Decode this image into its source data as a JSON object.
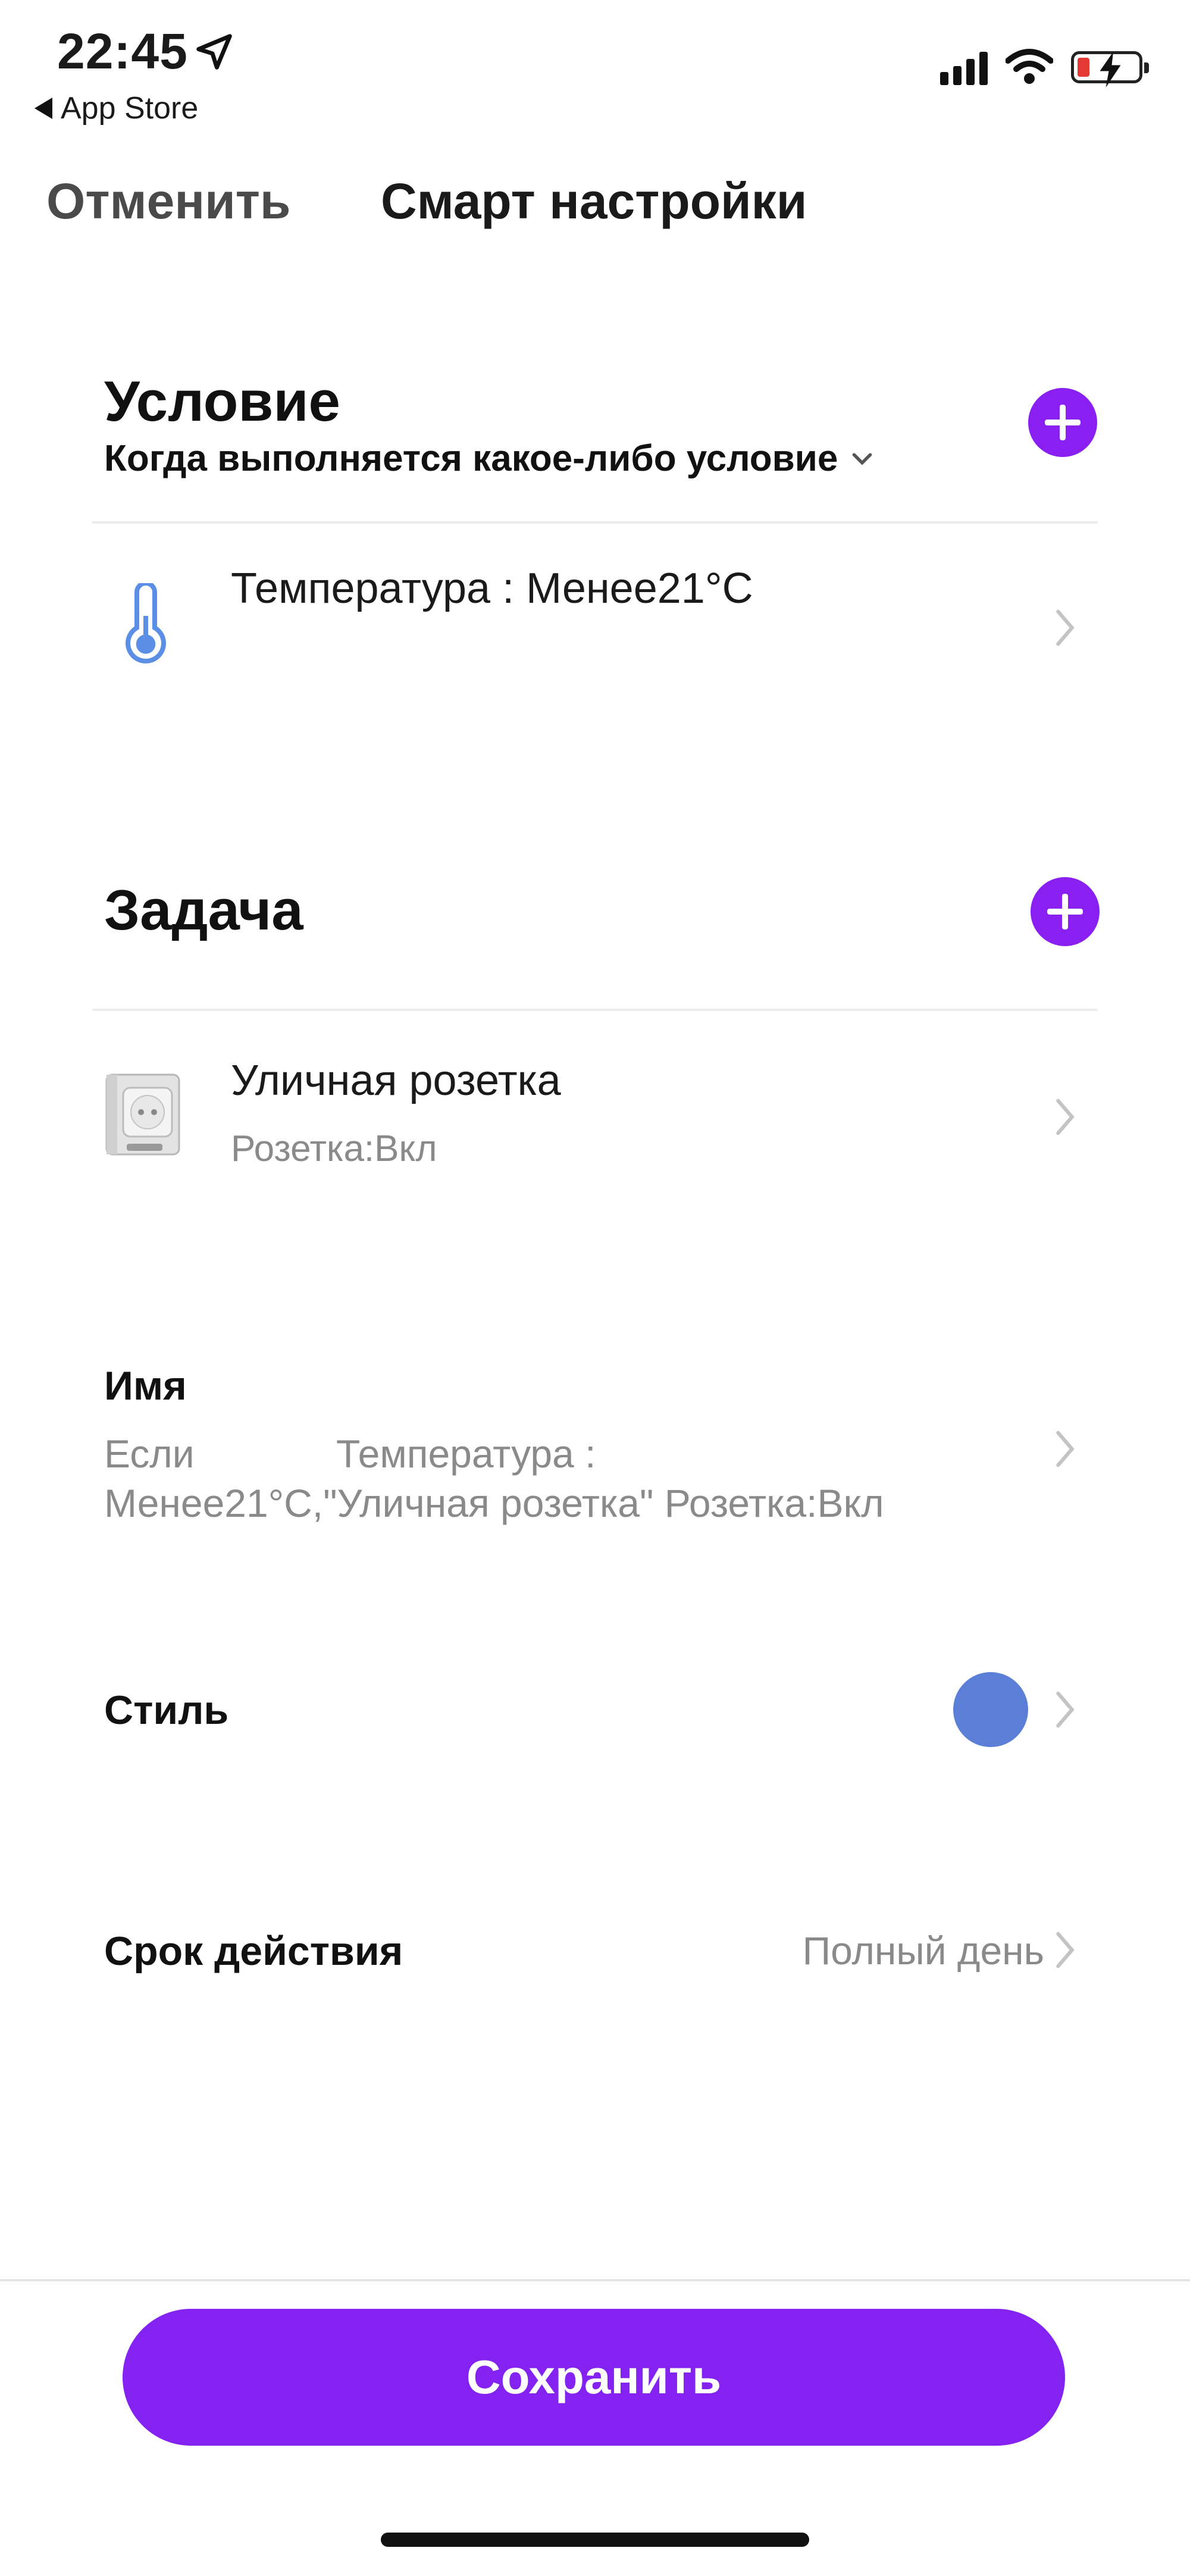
{
  "status_bar": {
    "time": "22:45",
    "back_app": "App Store",
    "battery_color": "#e53935"
  },
  "header": {
    "cancel_label": "Отменить",
    "title": "Смарт настройки"
  },
  "condition": {
    "heading": "Условие",
    "mode_label": "Когда выполняется какое-либо условие",
    "items": [
      {
        "icon": "thermometer-icon",
        "title": "Температура : Менее21°C"
      }
    ]
  },
  "task": {
    "heading": "Задача",
    "items": [
      {
        "icon": "outdoor-socket-icon",
        "title": "Уличная розетка",
        "subtitle": "Розетка:Вкл"
      }
    ]
  },
  "name": {
    "label": "Имя",
    "value_line1": "Если             Температура :",
    "value_line2": "Менее21°C,\"Уличная розетка\" Розетка:Вкл"
  },
  "style": {
    "label": "Стиль",
    "color": "#5b7fd6"
  },
  "validity": {
    "label": "Срок действия",
    "value": "Полный день"
  },
  "footer": {
    "save_label": "Сохранить",
    "accent": "#8422f2"
  }
}
